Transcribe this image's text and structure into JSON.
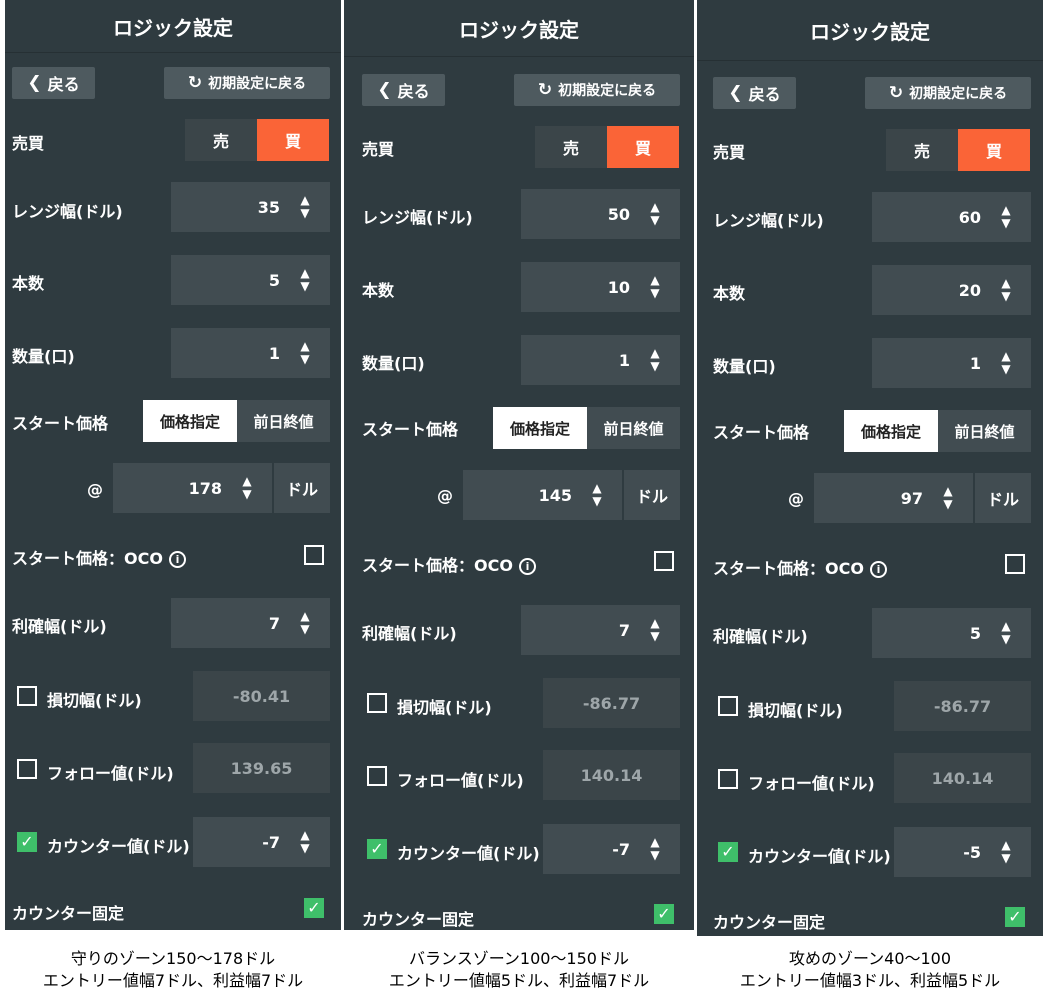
{
  "labels": {
    "title": "ロジック設定",
    "back": "戻る",
    "reset": "初期設定に戻る",
    "trade": "売買",
    "sell": "売",
    "buy": "買",
    "range": "レンジ幅(ドル)",
    "count": "本数",
    "qty": "数量(口)",
    "start": "スタート価格",
    "price_spec": "価格指定",
    "prev_close": "前日終値",
    "at": "@",
    "dollar": "ドル",
    "oco": "スタート価格：OCO",
    "tp": "利確幅(ドル)",
    "sl": "損切幅(ドル)",
    "follow": "フォロー値(ドル)",
    "counter": "カウンター値(ドル)",
    "counter_fixed": "カウンター固定"
  },
  "icons": {
    "back": "chevron-left-icon",
    "reset": "refresh-icon",
    "info": "info-icon",
    "check": "checkmark-icon",
    "stepper": "up-down-arrow-icon"
  },
  "colors": {
    "panel_bg": "#2f3b40",
    "accent_buy": "#fa6437",
    "checkbox_green": "#3fbf6a"
  },
  "panels": [
    {
      "range": "35",
      "count": "5",
      "qty": "1",
      "start_price": "178",
      "tp": "7",
      "sl": "-80.41",
      "follow": "139.65",
      "counter": "-7",
      "caption_line1": "守りのゾーン150～178ドル",
      "caption_line2": "エントリー値幅7ドル、利益幅7ドル"
    },
    {
      "range": "50",
      "count": "10",
      "qty": "1",
      "start_price": "145",
      "tp": "7",
      "sl": "-86.77",
      "follow": "140.14",
      "counter": "-7",
      "caption_line1": "バランスゾーン100～150ドル",
      "caption_line2": "エントリー値幅5ドル、利益幅7ドル"
    },
    {
      "range": "60",
      "count": "20",
      "qty": "1",
      "start_price": "97",
      "tp": "5",
      "sl": "-86.77",
      "follow": "140.14",
      "counter": "-5",
      "caption_line1": "攻めのゾーン40～100",
      "caption_line2": "エントリー値幅3ドル、利益幅5ドル"
    }
  ]
}
